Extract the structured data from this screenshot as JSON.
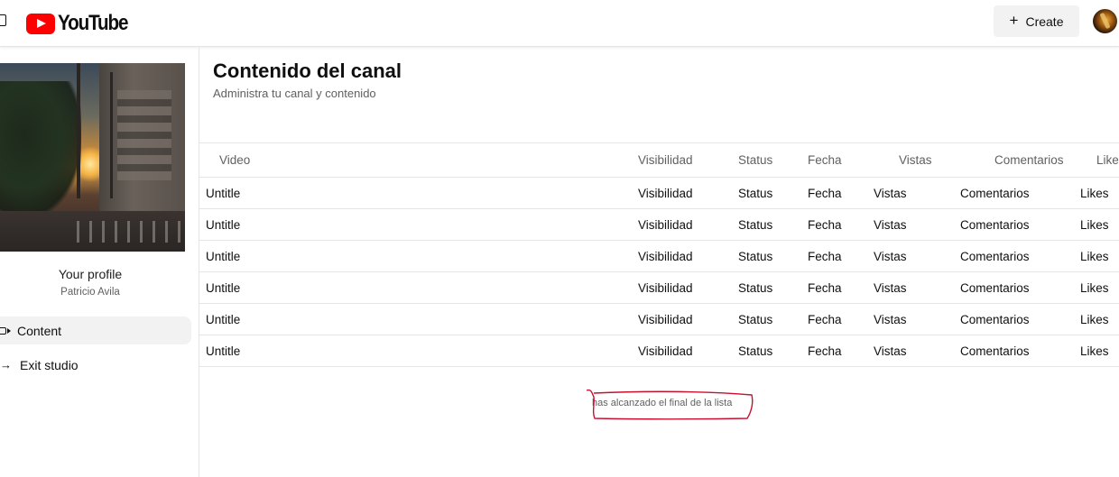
{
  "header": {
    "logo_text": "YouTube",
    "create_label": "Create",
    "create_icon": "plus-icon"
  },
  "sidebar": {
    "profile_title": "Your profile",
    "profile_name": "Patricio Avila",
    "items": [
      {
        "label": "Content",
        "icon": "video-camera-icon",
        "active": true
      },
      {
        "label": "Exit studio",
        "icon": "exit-arrow-icon",
        "active": false
      }
    ]
  },
  "main": {
    "title": "Contenido del canal",
    "subtitle": "Administra tu canal y contenido",
    "columns": [
      "Video",
      "Visibilidad",
      "Status",
      "Fecha",
      "Vistas",
      "Comentarios",
      "Likes"
    ],
    "rows": [
      [
        "Untitle",
        "Visibilidad",
        "Status",
        "Fecha",
        "Vistas",
        "Comentarios",
        "Likes"
      ],
      [
        "Untitle",
        "Visibilidad",
        "Status",
        "Fecha",
        "Vistas",
        "Comentarios",
        "Likes"
      ],
      [
        "Untitle",
        "Visibilidad",
        "Status",
        "Fecha",
        "Vistas",
        "Comentarios",
        "Likes"
      ],
      [
        "Untitle",
        "Visibilidad",
        "Status",
        "Fecha",
        "Vistas",
        "Comentarios",
        "Likes"
      ],
      [
        "Untitle",
        "Visibilidad",
        "Status",
        "Fecha",
        "Vistas",
        "Comentarios",
        "Likes"
      ],
      [
        "Untitle",
        "Visibilidad",
        "Status",
        "Fecha",
        "Vistas",
        "Comentarios",
        "Likes"
      ]
    ],
    "end_message": "has alcanzado el final de la lista"
  },
  "colors": {
    "brand_red": "#ff0000",
    "annotation_red": "#c8102e"
  }
}
